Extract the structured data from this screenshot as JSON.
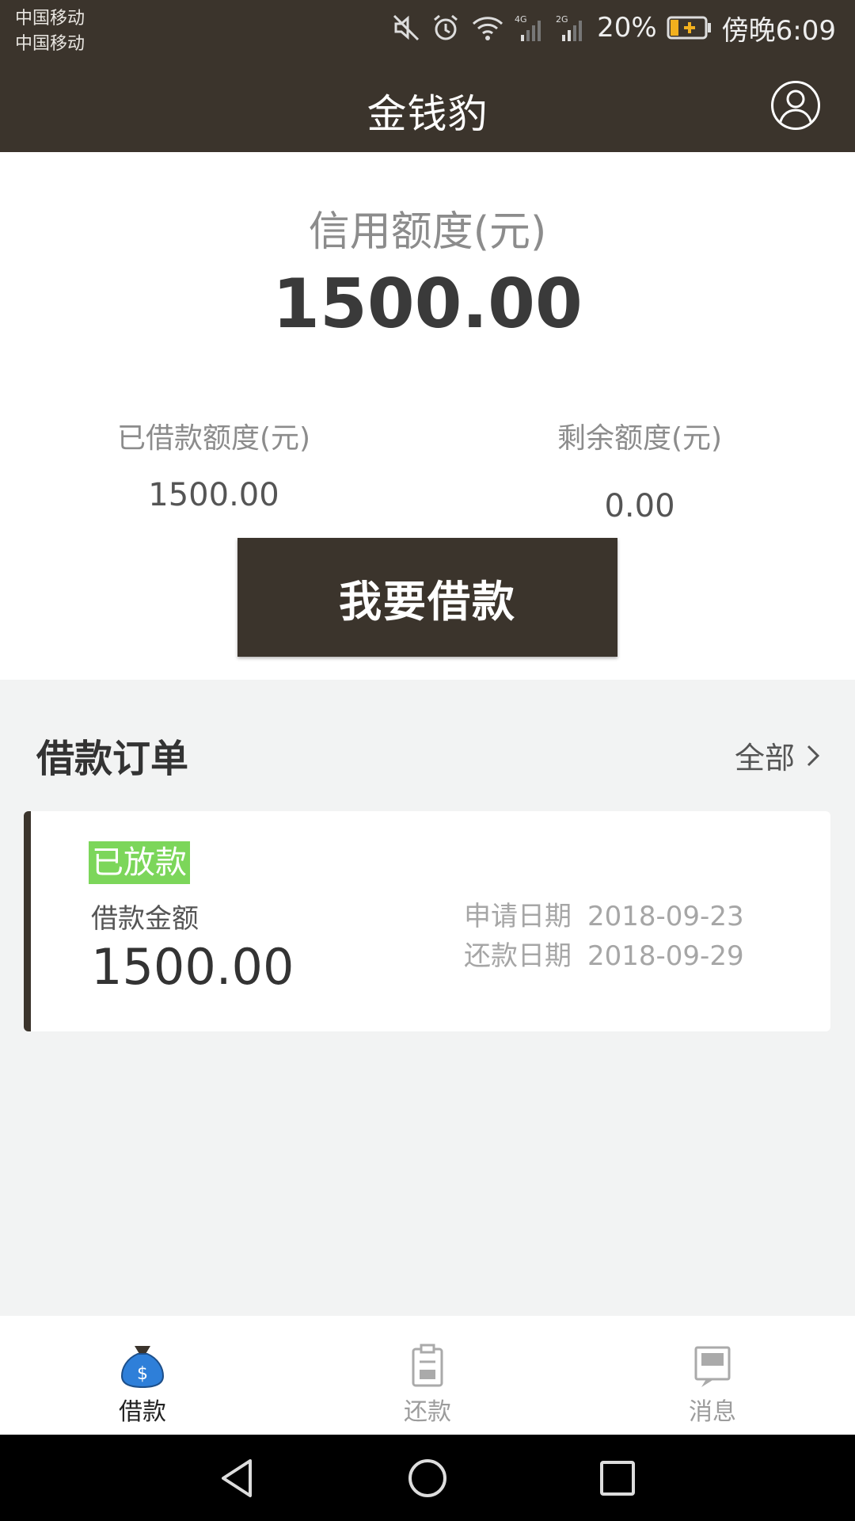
{
  "status_bar": {
    "carrier_1": "中国移动",
    "carrier_2": "中国移动",
    "network_1": "4G",
    "network_2": "2G",
    "battery": "20%",
    "time": "傍晚6:09"
  },
  "app_bar": {
    "title": "金钱豹",
    "profile_icon": "user-avatar-icon"
  },
  "credit": {
    "label": "信用额度(元)",
    "value": "1500.00",
    "borrowed_label": "已借款额度(元)",
    "borrowed_value": "1500.00",
    "remaining_label": "剩余额度(元)",
    "remaining_value": "0.00",
    "borrow_button": "我要借款"
  },
  "orders": {
    "title": "借款订单",
    "all_link": "全部",
    "items": [
      {
        "status": "已放款",
        "amount_label": "借款金额",
        "amount": "1500.00",
        "apply_label": "申请日期",
        "apply_date": "2018-09-23",
        "repay_label": "还款日期",
        "repay_date": "2018-09-29"
      }
    ]
  },
  "tabs": [
    {
      "label": "借款",
      "icon": "money-bag-icon",
      "active": true
    },
    {
      "label": "还款",
      "icon": "clipboard-icon",
      "active": false
    },
    {
      "label": "消息",
      "icon": "message-icon",
      "active": false
    }
  ],
  "colors": {
    "header_bg": "#3b342c",
    "badge_green": "#7cd65a",
    "active_icon_blue": "#2e7fd9"
  }
}
